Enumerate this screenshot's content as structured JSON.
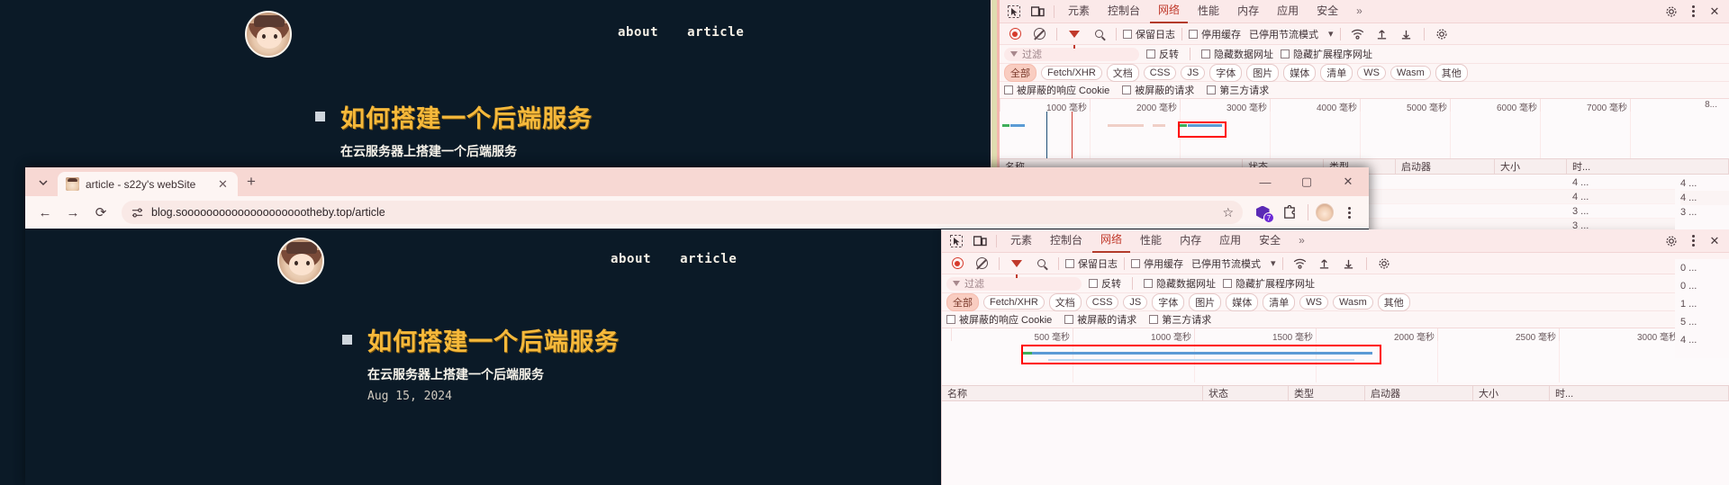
{
  "blog": {
    "nav": {
      "links": [
        "about",
        "article"
      ]
    },
    "post": {
      "title": "如何搭建一个后端服务",
      "subtitle": "在云服务器上搭建一个后端服务",
      "date": "Aug 15, 2024"
    }
  },
  "browser": {
    "tab": {
      "title": "article - s22y's webSite",
      "close": "✕"
    },
    "new_tab": "+",
    "window_controls": {
      "minimize": "—",
      "maximize": "▢",
      "close": "✕"
    },
    "nav": {
      "back": "←",
      "forward": "→",
      "reload": "⟳"
    },
    "omnibox": {
      "url": "blog.sooooooooooooooooooootheby.top/article",
      "site_icon": "tune-icon",
      "star": "☆"
    },
    "extension_badge_count": "7"
  },
  "devtools_top": {
    "tabs": [
      "元素",
      "控制台",
      "网络",
      "性能",
      "内存",
      "应用",
      "安全"
    ],
    "active_tab": "网络",
    "overflow": "»",
    "settings_icon": "gear-icon",
    "more_icon": "kebab-icon",
    "close_icon": "close-icon",
    "toolbar": {
      "record": "record-icon",
      "clear": "clear-icon",
      "filter": "filter-icon",
      "search": "search-icon",
      "preserve_log": "保留日志",
      "disable_cache": "停用缓存",
      "throttling": "已停用节流模式",
      "throttle_caret": "▾",
      "wifi_icon": "network-conditions-icon",
      "import_icon": "import-har-icon",
      "export_icon": "export-har-icon",
      "settings_icon": "gear-icon"
    },
    "filter": {
      "placeholder": "过滤",
      "invert": "反转",
      "hide_data_urls": "隐藏数据网址",
      "hide_ext_urls": "隐藏扩展程序网址"
    },
    "types": [
      "全部",
      "Fetch/XHR",
      "文档",
      "CSS",
      "JS",
      "字体",
      "图片",
      "媒体",
      "清单",
      "WS",
      "Wasm",
      "其他"
    ],
    "active_type": "全部",
    "checkboxes": [
      "被屏蔽的响应 Cookie",
      "被屏蔽的请求",
      "第三方请求"
    ],
    "timeline_ticks": [
      "1000 毫秒",
      "2000 毫秒",
      "3000 毫秒",
      "4000 毫秒",
      "5000 毫秒",
      "6000 毫秒",
      "7000 毫秒",
      "8..."
    ],
    "columns": [
      "名称",
      "状态",
      "类型",
      "启动器",
      "大小",
      "时..."
    ],
    "time_values": [
      "4 ...",
      "4 ...",
      "3 ...",
      "3 ...",
      "3 ...",
      "3 ...",
      "3 ...",
      "4 ..."
    ]
  },
  "devtools_bottom": {
    "tabs": [
      "元素",
      "控制台",
      "网络",
      "性能",
      "内存",
      "应用",
      "安全"
    ],
    "active_tab": "网络",
    "overflow": "»",
    "settings_icon": "gear-icon",
    "more_icon": "kebab-icon",
    "close_icon": "close-icon",
    "toolbar": {
      "preserve_log": "保留日志",
      "disable_cache": "停用缓存",
      "throttling": "已停用节流模式",
      "throttle_caret": "▾"
    },
    "filter": {
      "placeholder": "过滤",
      "invert": "反转",
      "hide_data_urls": "隐藏数据网址",
      "hide_ext_urls": "隐藏扩展程序网址"
    },
    "types": [
      "全部",
      "Fetch/XHR",
      "文档",
      "CSS",
      "JS",
      "字体",
      "图片",
      "媒体",
      "清单",
      "WS",
      "Wasm",
      "其他"
    ],
    "active_type": "全部",
    "checkboxes": [
      "被屏蔽的响应 Cookie",
      "被屏蔽的请求",
      "第三方请求"
    ],
    "timeline_ticks": [
      "500 毫秒",
      "1000 毫秒",
      "1500 毫秒",
      "2000 毫秒",
      "2500 毫秒",
      "3000 毫秒"
    ],
    "columns": [
      "名称",
      "状态",
      "类型",
      "启动器",
      "大小",
      "时..."
    ],
    "status_values": [
      "0 ...",
      "0 ...",
      "1 ...",
      "5 ...",
      "4 ..."
    ]
  },
  "colors": {
    "blog_bg": "#0b1a27",
    "blog_title": "#f6b93b",
    "devtools_bg": "#fdf9fa",
    "accent_red": "#c0392b",
    "highlight": "#ff0000"
  }
}
